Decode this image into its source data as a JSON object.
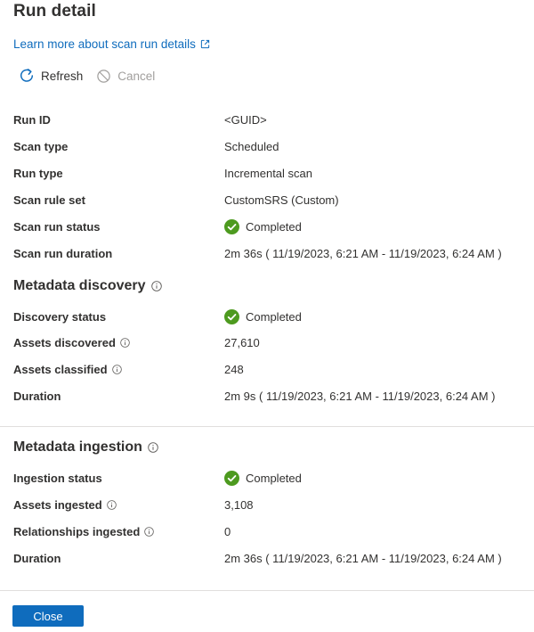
{
  "header": {
    "title": "Run detail",
    "learn_more": "Learn more about scan run details"
  },
  "toolbar": {
    "refresh_label": "Refresh",
    "cancel_label": "Cancel"
  },
  "run": {
    "run_id_label": "Run ID",
    "run_id_value": "<GUID>",
    "scan_type_label": "Scan type",
    "scan_type_value": "Scheduled",
    "run_type_label": "Run type",
    "run_type_value": "Incremental scan",
    "rule_set_label": "Scan rule set",
    "rule_set_value": "CustomSRS (Custom)",
    "status_label": "Scan run status",
    "status_value": "Completed",
    "duration_label": "Scan run duration",
    "duration_value": "2m 36s ( 11/19/2023, 6:21 AM - 11/19/2023, 6:24 AM )"
  },
  "discovery": {
    "title": "Metadata discovery",
    "status_label": "Discovery status",
    "status_value": "Completed",
    "assets_discovered_label": "Assets discovered",
    "assets_discovered_value": "27,610",
    "assets_classified_label": "Assets classified",
    "assets_classified_value": "248",
    "duration_label": "Duration",
    "duration_value": "2m 9s ( 11/19/2023, 6:21 AM - 11/19/2023, 6:24 AM )"
  },
  "ingestion": {
    "title": "Metadata ingestion",
    "status_label": "Ingestion status",
    "status_value": "Completed",
    "assets_ingested_label": "Assets ingested",
    "assets_ingested_value": "3,108",
    "relationships_label": "Relationships ingested",
    "relationships_value": "0",
    "duration_label": "Duration",
    "duration_value": "2m 36s ( 11/19/2023, 6:21 AM - 11/19/2023, 6:24 AM )"
  },
  "footer": {
    "close_label": "Close"
  },
  "colors": {
    "link": "#0f6cbd",
    "success": "#4d9a1f",
    "primary_button": "#0f6cbd",
    "text": "#323130",
    "disabled": "#a19f9d"
  },
  "icons": {
    "external": "external-link-icon",
    "refresh": "refresh-icon",
    "cancel": "cancel-icon",
    "success": "checkmark-circle-icon",
    "info": "info-icon"
  }
}
